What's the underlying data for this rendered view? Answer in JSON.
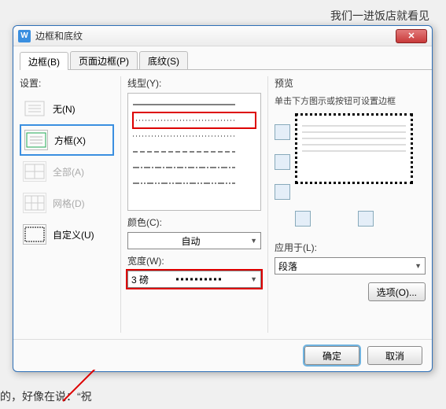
{
  "bg": {
    "t1": "我们一进饭店就看见",
    "t2": "的，好像在说：“祝"
  },
  "dialog": {
    "title": "边框和底纹",
    "tabs": [
      {
        "label": "边框(B)"
      },
      {
        "label": "页面边框(P)"
      },
      {
        "label": "底纹(S)"
      }
    ],
    "settings": {
      "heading": "设置:",
      "items": [
        {
          "label": "无(N)"
        },
        {
          "label": "方框(X)"
        },
        {
          "label": "全部(A)"
        },
        {
          "label": "网格(D)"
        },
        {
          "label": "自定义(U)"
        }
      ]
    },
    "linestyle": {
      "heading": "线型(Y):"
    },
    "color": {
      "heading": "颜色(C):",
      "value": "自动"
    },
    "width": {
      "heading": "宽度(W):",
      "value": "3    磅"
    },
    "preview": {
      "heading": "预览",
      "hint": "单击下方图示或按钮可设置边框",
      "apply_label": "应用于(L):",
      "apply_value": "段落",
      "options_btn": "选项(O)..."
    },
    "footer": {
      "ok": "确定",
      "cancel": "取消"
    }
  }
}
